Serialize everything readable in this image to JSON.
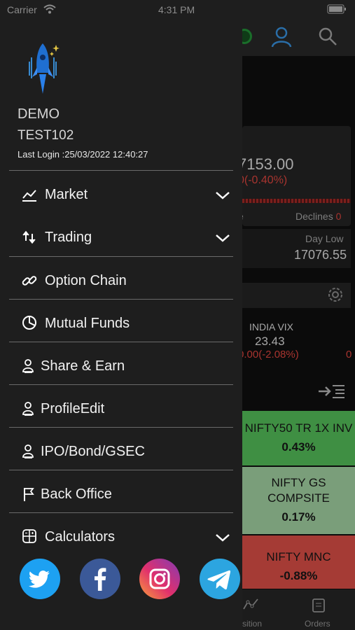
{
  "status_bar": {
    "carrier": "Carrier",
    "time": "4:31 PM"
  },
  "drawer": {
    "user": {
      "name": "DEMO",
      "id": "TEST102",
      "last_login": "Last Login :25/03/2022 12:40:27"
    },
    "menu": [
      {
        "label": "Market",
        "icon": "chart-line-icon",
        "expandable": true
      },
      {
        "label": "Trading",
        "icon": "arrows-up-down-icon",
        "expandable": true
      },
      {
        "label": "Option Chain",
        "icon": "link-icon",
        "expandable": false
      },
      {
        "label": "Mutual Funds",
        "icon": "pie-chart-icon",
        "expandable": false
      },
      {
        "label": "Share & Earn",
        "icon": "person-icon",
        "expandable": false
      },
      {
        "label": "ProfileEdit",
        "icon": "person-icon",
        "expandable": false
      },
      {
        "label": "IPO/Bond/GSEC",
        "icon": "person-icon",
        "expandable": false
      },
      {
        "label": "Back Office",
        "icon": "flag-icon",
        "expandable": false
      },
      {
        "label": "Calculators",
        "icon": "calculator-icon",
        "expandable": true
      }
    ],
    "social": [
      {
        "name": "twitter",
        "color": "#1da1f2"
      },
      {
        "name": "facebook",
        "color": "#3b5998"
      },
      {
        "name": "instagram",
        "color": "#c13584"
      },
      {
        "name": "telegram",
        "color": "#2ca5e0"
      }
    ]
  },
  "background": {
    "index_price": "7153.00",
    "index_change": "0(-0.40%)",
    "declines_label": "Declines",
    "declines_value": "0",
    "advances_partial": "e",
    "day_low_label": "Day Low",
    "day_low_value": "17076.55",
    "vix_label": "INDIA VIX",
    "vix_value": "23.43",
    "vix_change": "0.00(-2.08%)",
    "vix_extra": "0",
    "tiles": [
      {
        "name": "NIFTY50 TR 1X INV",
        "change": "0.43%",
        "color": "#3f8f43"
      },
      {
        "name": "NIFTY GS COMPSITE",
        "change": "0.17%",
        "color": "#7a9e7a"
      },
      {
        "name": "NIFTY MNC",
        "change": "-0.88%",
        "color": "#a53b35"
      }
    ],
    "tabs": [
      {
        "label": "sition",
        "icon": "position-icon"
      },
      {
        "label": "Orders",
        "icon": "orders-icon"
      }
    ]
  }
}
